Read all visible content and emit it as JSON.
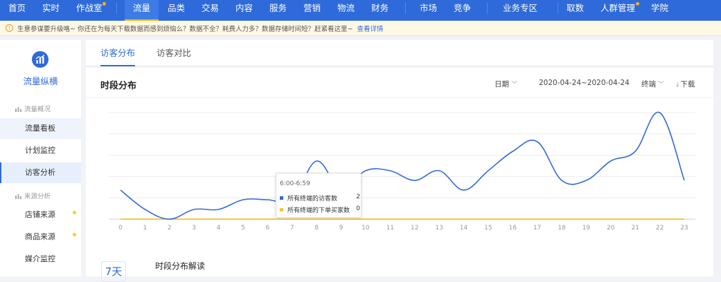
{
  "topnav": {
    "items": [
      {
        "label": "首页"
      },
      {
        "label": "实时"
      },
      {
        "label": "作战室"
      },
      {
        "label": "流量"
      },
      {
        "label": "品类"
      },
      {
        "label": "交易"
      },
      {
        "label": "内容"
      },
      {
        "label": "服务"
      },
      {
        "label": "营销"
      },
      {
        "label": "物流"
      },
      {
        "label": "财务"
      },
      {
        "label": "市场"
      },
      {
        "label": "竞争"
      },
      {
        "label": "业务专区"
      },
      {
        "label": "取数"
      },
      {
        "label": "人群管理"
      },
      {
        "label": "学院"
      }
    ],
    "active_index": 3
  },
  "notice": {
    "text": "生意参谋要升级咯~ 你还在为每天下载数据而感到烦恼么？数据不全？耗费人力多？数据存储时间短？赶紧看这里~",
    "link": "查看详情"
  },
  "sidebar": {
    "title": "流量纵横",
    "groups": [
      {
        "label": "流量概况",
        "items": [
          {
            "label": "流量看板"
          },
          {
            "label": "计划监控"
          },
          {
            "label": "访客分析"
          }
        ]
      },
      {
        "label": "来源分析",
        "items": [
          {
            "label": "店铺来源"
          },
          {
            "label": "商品来源"
          },
          {
            "label": "媒介监控"
          }
        ]
      }
    ],
    "current": "访客分析"
  },
  "tabs": [
    {
      "label": "访客分布"
    },
    {
      "label": "访客对比"
    }
  ],
  "panel": {
    "title": "时段分布",
    "date_label": "日期",
    "date_range": "2020-04-24~2020-04-24",
    "terminal_label": "终端",
    "download_label": "下载"
  },
  "tooltip": {
    "time": "6:00-6:59",
    "rows": [
      {
        "label": "所有终端的访客数",
        "value": "2"
      },
      {
        "label": "所有终端的下单买家数",
        "value": "0"
      }
    ]
  },
  "interpretation": {
    "title": "时段分布解读",
    "badge": "7天"
  },
  "colors": {
    "nav_bg": "#2e6ad9",
    "accent": "#ffb400",
    "visitors_series": "#2e6ad9",
    "buyers_series": "#f5c842"
  },
  "chart_data": {
    "type": "line",
    "x": [
      0,
      1,
      2,
      3,
      4,
      5,
      6,
      7,
      8,
      9,
      10,
      11,
      12,
      13,
      14,
      15,
      16,
      17,
      18,
      19,
      20,
      21,
      22,
      23
    ],
    "series": [
      {
        "name": "所有终端的访客数",
        "values": [
          3,
          1,
          0,
          1,
          1,
          2,
          2,
          2,
          6,
          3,
          5,
          5,
          4,
          5,
          3,
          5,
          7,
          8,
          4,
          4,
          6,
          7,
          11,
          4
        ]
      },
      {
        "name": "所有终端的下单买家数",
        "values": [
          0,
          0,
          0,
          0,
          0,
          0,
          0,
          0,
          0,
          0,
          0,
          0,
          0,
          0,
          0,
          0,
          0,
          0,
          0,
          0,
          0,
          0,
          0,
          0
        ]
      }
    ],
    "ylim": [
      0,
      11
    ],
    "grid": true,
    "legend": "tooltip"
  }
}
